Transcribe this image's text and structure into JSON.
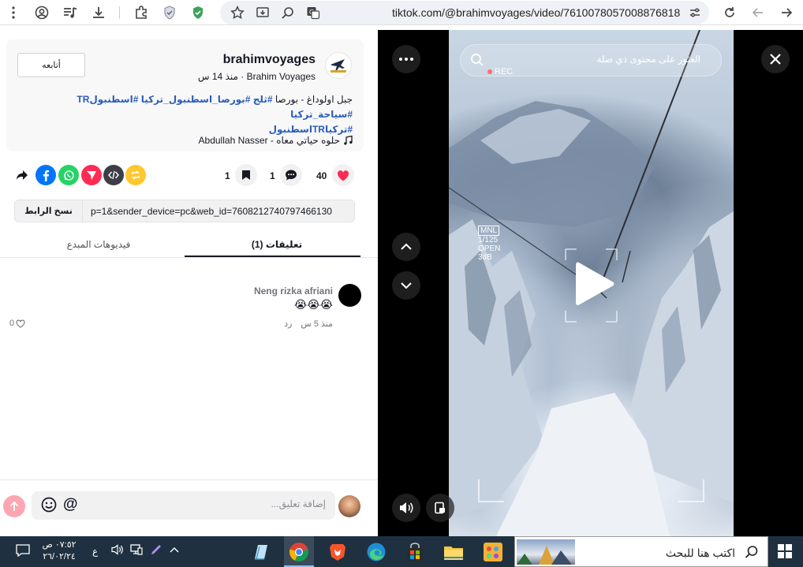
{
  "browser": {
    "url": "tiktok.com/@brahimvoyages/video/7610078057008876818"
  },
  "author": {
    "username": "brahimvoyages",
    "display_name": "Brahim Voyages",
    "time": "منذ 14 س",
    "follow_label": "أتابعه",
    "avatar_text": "BRAHIM VOYAGES"
  },
  "post": {
    "desc_plain": "جبل اولوداغ - بورصا",
    "tags_line1": "#ثلج #بورصا_اسطنبول_تركيا #اسطنبولTR #سياحة_تركيا",
    "tags_line2": "#تركياTRاسطنبول",
    "music": "حلوه حياتي معاه - Abdullah Nasser"
  },
  "stats": {
    "likes": "40",
    "comments": "1",
    "saves": "1"
  },
  "share": {
    "link": "p=1&sender_device=pc&web_id=7608212740797466130",
    "copy_label": "نسخ الرابط"
  },
  "tabs": {
    "comments": "(1) تعليقات",
    "creator_videos": "فيديوهات المبدع"
  },
  "comment": {
    "author": "Neng rizka afriani",
    "emojis": "😭😭😭",
    "time": "منذ 5 س",
    "reply": "رد",
    "likes": "0"
  },
  "comment_input": {
    "placeholder": "إضافة تعليق..."
  },
  "video": {
    "search_placeholder": "العثور على محتوى ذي صلة",
    "rec": "REC",
    "cam_mode": "MNL",
    "cam_shutter": "1/125",
    "cam_aperture": "OPEN",
    "cam_gain": "3dB"
  },
  "taskbar": {
    "search_placeholder": "اكتب هنا للبحث",
    "time": "٠٧:٥٢ ص",
    "date": "٢٦/٠٢/٢٤",
    "lang": "ع"
  },
  "colors": {
    "like_red": "#fe2c55",
    "tag_blue": "#2b5db9",
    "taskbar": "#1f3140"
  }
}
